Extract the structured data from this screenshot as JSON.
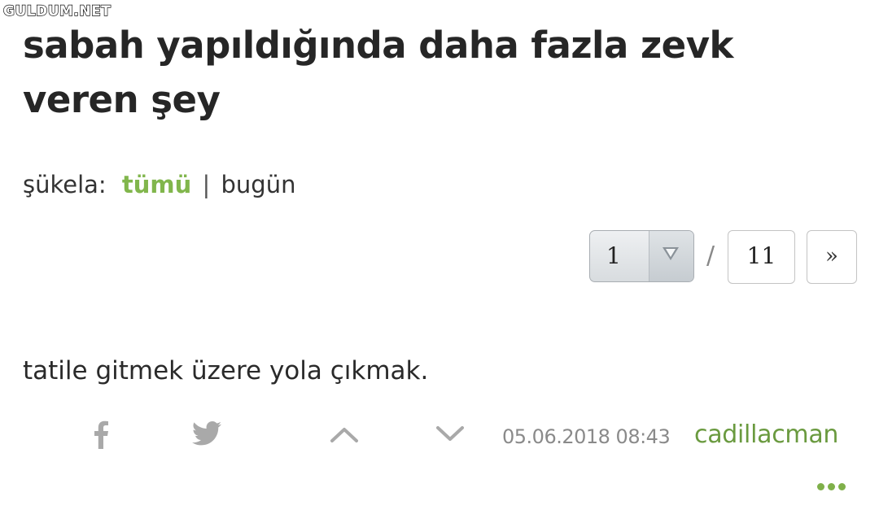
{
  "watermark": "GULDUM.NET",
  "topic": {
    "title": "sabah yapıldığında daha fazla zevk veren şey"
  },
  "filter": {
    "label": "şükela:",
    "active": "tümü",
    "separator": "|",
    "other": "bugün"
  },
  "pager": {
    "current_page": "1",
    "separator": "/",
    "total_pages": "11",
    "next_label": "»"
  },
  "entry": {
    "text": "tatile gitmek üzere yola çıkmak.",
    "date": "05.06.2018 08:43",
    "author": "cadillacman"
  },
  "icons": {
    "share_facebook": "facebook-icon",
    "share_twitter": "twitter-icon",
    "vote_up": "chevron-up-icon",
    "vote_down": "chevron-down-icon",
    "more": "more-dots-icon"
  },
  "colors": {
    "accent_green": "#81b64c",
    "author_green": "#6a9a3f",
    "icon_gray": "#a9a9a9",
    "date_gray": "#8a8a8a"
  }
}
